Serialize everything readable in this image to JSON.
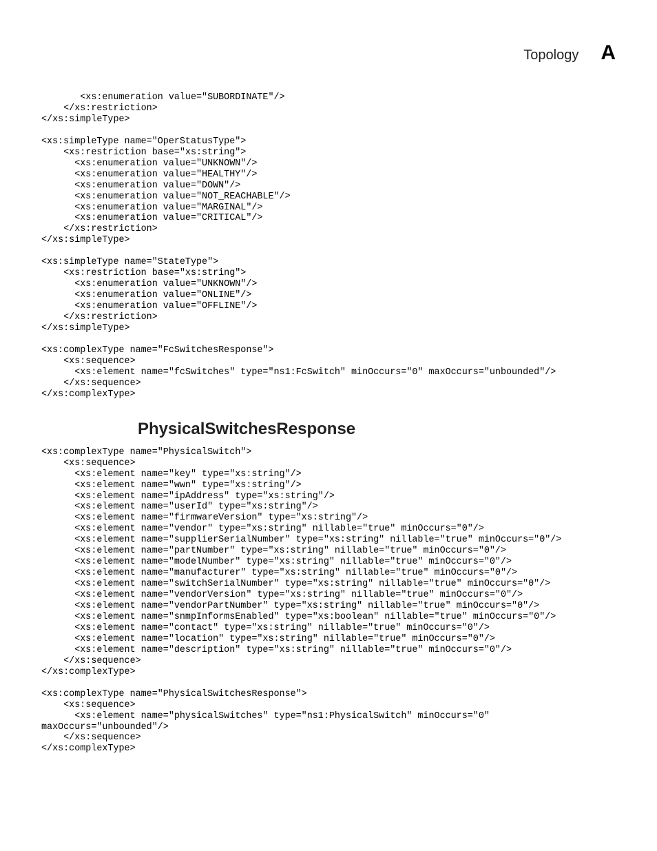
{
  "header": {
    "title": "Topology",
    "letter": "A"
  },
  "code1": "       <xs:enumeration value=\"SUBORDINATE\"/>\n    </xs:restriction>\n</xs:simpleType>\n\n<xs:simpleType name=\"OperStatusType\">\n    <xs:restriction base=\"xs:string\">\n      <xs:enumeration value=\"UNKNOWN\"/>\n      <xs:enumeration value=\"HEALTHY\"/>\n      <xs:enumeration value=\"DOWN\"/>\n      <xs:enumeration value=\"NOT_REACHABLE\"/>\n      <xs:enumeration value=\"MARGINAL\"/>\n      <xs:enumeration value=\"CRITICAL\"/>\n    </xs:restriction>\n</xs:simpleType>\n\n<xs:simpleType name=\"StateType\">\n    <xs:restriction base=\"xs:string\">\n      <xs:enumeration value=\"UNKNOWN\"/>\n      <xs:enumeration value=\"ONLINE\"/>\n      <xs:enumeration value=\"OFFLINE\"/>\n    </xs:restriction>\n</xs:simpleType>\n\n<xs:complexType name=\"FcSwitchesResponse\">\n    <xs:sequence>\n      <xs:element name=\"fcSwitches\" type=\"ns1:FcSwitch\" minOccurs=\"0\" maxOccurs=\"unbounded\"/>\n    </xs:sequence>\n</xs:complexType>",
  "section_title": "PhysicalSwitchesResponse",
  "code2": "<xs:complexType name=\"PhysicalSwitch\">\n    <xs:sequence>\n      <xs:element name=\"key\" type=\"xs:string\"/>\n      <xs:element name=\"wwn\" type=\"xs:string\"/>\n      <xs:element name=\"ipAddress\" type=\"xs:string\"/>\n      <xs:element name=\"userId\" type=\"xs:string\"/>\n      <xs:element name=\"firmwareVersion\" type=\"xs:string\"/>\n      <xs:element name=\"vendor\" type=\"xs:string\" nillable=\"true\" minOccurs=\"0\"/>\n      <xs:element name=\"supplierSerialNumber\" type=\"xs:string\" nillable=\"true\" minOccurs=\"0\"/>\n      <xs:element name=\"partNumber\" type=\"xs:string\" nillable=\"true\" minOccurs=\"0\"/>\n      <xs:element name=\"modelNumber\" type=\"xs:string\" nillable=\"true\" minOccurs=\"0\"/>\n      <xs:element name=\"manufacturer\" type=\"xs:string\" nillable=\"true\" minOccurs=\"0\"/>\n      <xs:element name=\"switchSerialNumber\" type=\"xs:string\" nillable=\"true\" minOccurs=\"0\"/>\n      <xs:element name=\"vendorVersion\" type=\"xs:string\" nillable=\"true\" minOccurs=\"0\"/>\n      <xs:element name=\"vendorPartNumber\" type=\"xs:string\" nillable=\"true\" minOccurs=\"0\"/>\n      <xs:element name=\"snmpInformsEnabled\" type=\"xs:boolean\" nillable=\"true\" minOccurs=\"0\"/>\n      <xs:element name=\"contact\" type=\"xs:string\" nillable=\"true\" minOccurs=\"0\"/>\n      <xs:element name=\"location\" type=\"xs:string\" nillable=\"true\" minOccurs=\"0\"/>\n      <xs:element name=\"description\" type=\"xs:string\" nillable=\"true\" minOccurs=\"0\"/>\n    </xs:sequence>\n</xs:complexType>\n\n<xs:complexType name=\"PhysicalSwitchesResponse\">\n    <xs:sequence>\n      <xs:element name=\"physicalSwitches\" type=\"ns1:PhysicalSwitch\" minOccurs=\"0\" \nmaxOccurs=\"unbounded\"/>\n    </xs:sequence>\n</xs:complexType>"
}
